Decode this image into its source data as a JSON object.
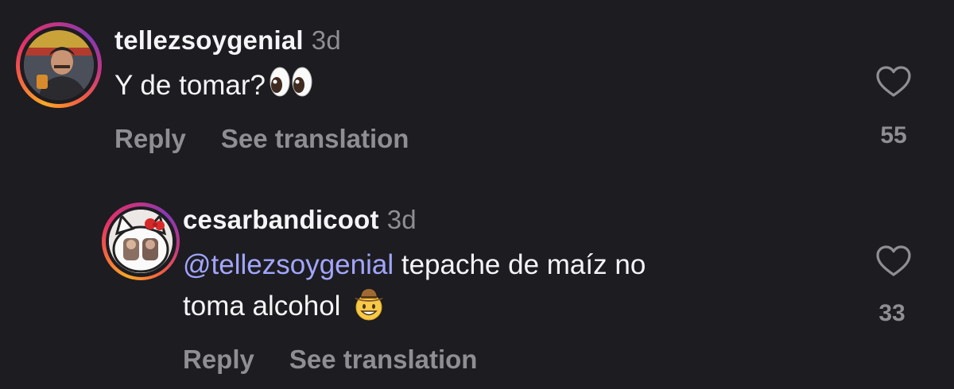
{
  "comments": [
    {
      "username": "tellezsoygenial",
      "time": "3d",
      "text": "Y de tomar?",
      "emoji": "eyes-emoji",
      "reply_label": "Reply",
      "translate_label": "See translation",
      "like_count": "55"
    },
    {
      "username": "cesarbandicoot",
      "time": "3d",
      "mention": "@tellezsoygenial",
      "text_line1": " tepache de maíz no",
      "text_line2": "toma alcohol",
      "emoji": "cowboy-hat-face-emoji",
      "reply_label": "Reply",
      "translate_label": "See translation",
      "like_count": "33"
    }
  ],
  "colors": {
    "background": "#1c1c21",
    "text": "#f5f5f7",
    "muted": "#8e8e93",
    "mention": "#a3a6ff"
  }
}
